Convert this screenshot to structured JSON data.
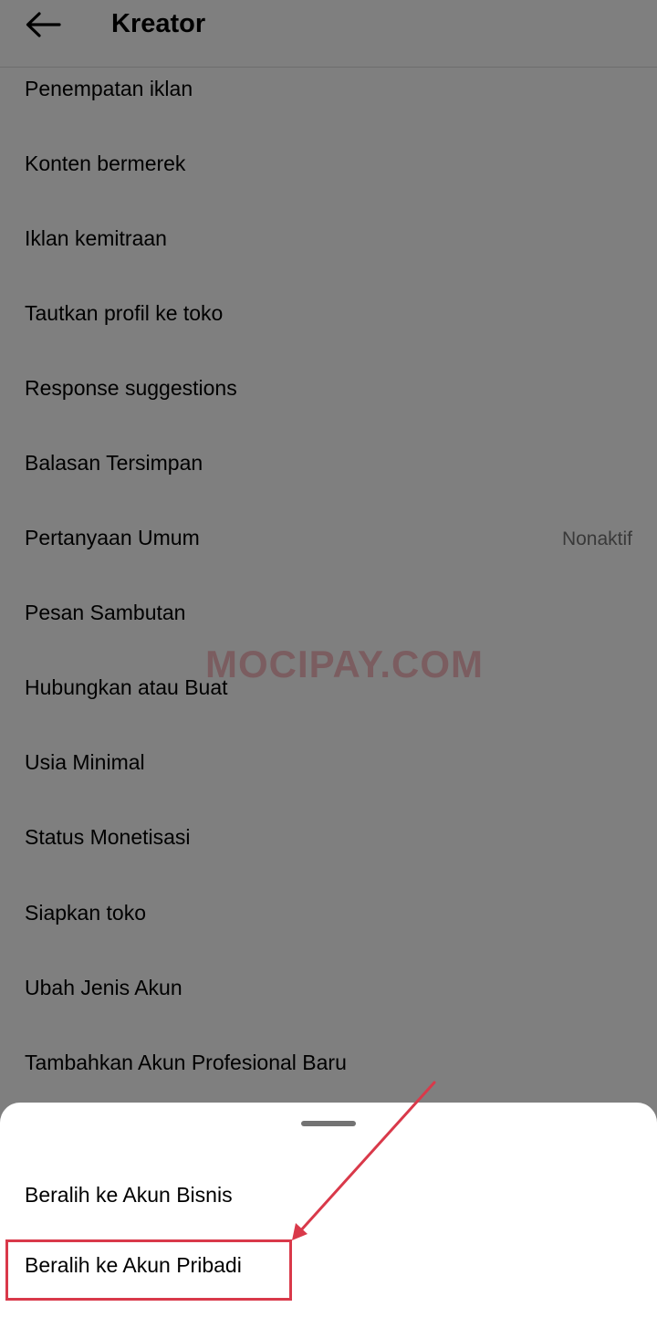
{
  "header": {
    "title": "Kreator",
    "back_icon": "arrow-left-icon"
  },
  "settings_list": {
    "items": [
      {
        "label": "Penempatan iklan",
        "value": ""
      },
      {
        "label": "Konten bermerek",
        "value": ""
      },
      {
        "label": "Iklan kemitraan",
        "value": ""
      },
      {
        "label": "Tautkan profil ke toko",
        "value": ""
      },
      {
        "label": "Response suggestions",
        "value": ""
      },
      {
        "label": "Balasan Tersimpan",
        "value": ""
      },
      {
        "label": "Pertanyaan Umum",
        "value": "Nonaktif"
      },
      {
        "label": "Pesan Sambutan",
        "value": ""
      },
      {
        "label": "Hubungkan atau Buat",
        "value": ""
      },
      {
        "label": "Usia Minimal",
        "value": ""
      },
      {
        "label": "Status Monetisasi",
        "value": ""
      },
      {
        "label": "Siapkan toko",
        "value": ""
      },
      {
        "label": "Ubah Jenis Akun",
        "value": ""
      },
      {
        "label": "Tambahkan Akun Profesional Baru",
        "value": ""
      }
    ]
  },
  "watermark": "MOCIPAY.COM",
  "bottom_sheet": {
    "options": [
      {
        "label": "Beralih ke Akun Bisnis"
      },
      {
        "label": "Beralih ke Akun Pribadi"
      }
    ]
  },
  "colors": {
    "overlay": "rgba(0,0,0,0.5)",
    "annotation": "#d9394a",
    "secondary_text": "#737373"
  }
}
